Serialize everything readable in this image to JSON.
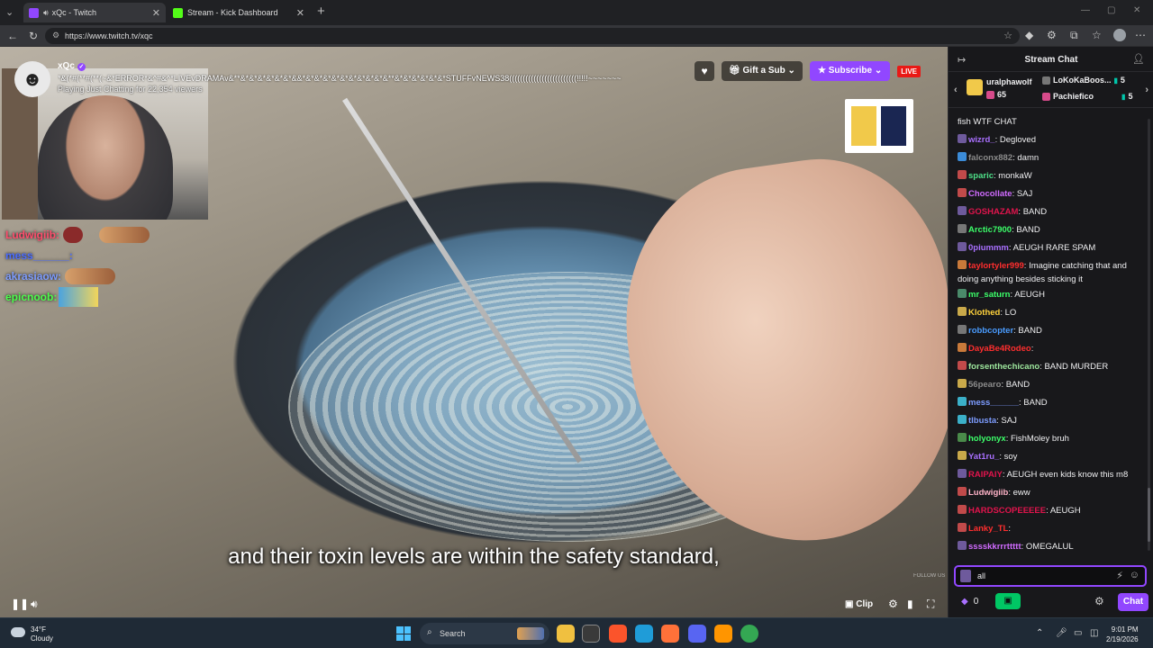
{
  "browser": {
    "tabs": [
      {
        "title": "xQc - Twitch",
        "active": true,
        "audio": true,
        "favicon_color": "#9147ff"
      },
      {
        "title": "Stream - Kick Dashboard",
        "active": false,
        "audio": false,
        "favicon_color": "#53fc18"
      }
    ],
    "url": "https://www.twitch.tv/xqc"
  },
  "stream": {
    "channel": "xQc",
    "title": "*&(*#(**#(**(~&*ERROR*&^#&^*LIVEvDRAMAv&**&*&*&*&*&*&*&&*&*&*&*&*&*&*&*&*&*&**&*&*&*&*&*&*STUFFvNEWS38(((((((((((((((((((((((((!!!!!~~~~~~~",
    "meta": "Playing Just Chatting for 22,354 viewers",
    "gift_label": "Gift a Sub",
    "subscribe_label": "Subscribe",
    "live_label": "LIVE",
    "caption": "and their toxin levels are within the safety standard,",
    "watermark": "FOLLOW US",
    "clip_label": "Clip",
    "overlay_chat": [
      {
        "user": "Ludwigiib:",
        "color": "#ff4d6d"
      },
      {
        "user": "mess______:",
        "color": "#4a6cff"
      },
      {
        "user": "akrasiaow:",
        "color": "#7d9cff"
      },
      {
        "user": "epicnoob:",
        "color": "#4cff4c"
      }
    ]
  },
  "chat": {
    "header": "Stream Chat",
    "gifters": [
      {
        "name": "uralphawolf",
        "count": "65"
      },
      {
        "name": "LoKoKaBoos...",
        "count": "5"
      },
      {
        "name": "Pachiefico",
        "count": "5"
      }
    ],
    "messages": [
      {
        "user": "",
        "text": "fish WTF CHAT",
        "color": "#efeff1",
        "badge": ""
      },
      {
        "user": "wizrd_",
        "text": ": Degloved",
        "color": "#a970ff",
        "badge": "#6e5a9c"
      },
      {
        "user": "falconx882",
        "text": ": damn",
        "color": "#8b8b8b",
        "badge": "#3b8bd8"
      },
      {
        "user": "sparic",
        "text": ": monkaW",
        "color": "#4ee089",
        "badge": "#c14a4a"
      },
      {
        "user": "Chocollate",
        "text": ": SAJ",
        "color": "#d06bff",
        "badge": "#c14a4a"
      },
      {
        "user": "GOSHAZAM",
        "text": ": BAND",
        "color": "#e0144c",
        "badge": "#6e5a9c"
      },
      {
        "user": "Arctic7900",
        "text": ": BAND",
        "color": "#3cff6a",
        "badge": "#777"
      },
      {
        "user": "0piummm",
        "text": ": AEUGH RARE SPAM",
        "color": "#a970ff",
        "badge": "#6e5a9c"
      },
      {
        "user": "taylortyler999",
        "text": ": Imagine catching that and doing anything besides sticking it",
        "color": "#ff2e2e",
        "badge": "#c97a3a"
      },
      {
        "user": "mr_saturn",
        "text": ": AEUGH",
        "color": "#3cff6a",
        "badge": "#4a8a6a"
      },
      {
        "user": "Klothed",
        "text": ": LO",
        "color": "#ffd23c",
        "badge": "#c9a94a"
      },
      {
        "user": "robbcopter",
        "text": ": BAND",
        "color": "#4a9cff",
        "badge": "#777"
      },
      {
        "user": "DayaBe4Rodeo",
        "text": ":",
        "color": "#ff2e2e",
        "badge": "#c97a3a"
      },
      {
        "user": "forsenthechicano",
        "text": ": BAND MURDER",
        "color": "#9ee89e",
        "badge": "#c14a4a"
      },
      {
        "user": "56pearo",
        "text": ": BAND",
        "color": "#8b8b8b",
        "badge": "#c9a94a"
      },
      {
        "user": "mess______",
        "text": ": BAND",
        "color": "#7d9cff",
        "badge": "#3bb0c9"
      },
      {
        "user": "tlbusta",
        "text": ": SAJ",
        "color": "#7d9cff",
        "badge": "#3bb0c9"
      },
      {
        "user": "holyonyx",
        "text": ": FishMoley bruh",
        "color": "#3cff6a",
        "badge": "#4a8a4a"
      },
      {
        "user": "Yat1ru_",
        "text": ": soy",
        "color": "#a970ff",
        "badge": "#c9a94a"
      },
      {
        "user": "RAIPAIY",
        "text": ": AEUGH even kids know this m8",
        "color": "#e0144c",
        "badge": "#6e5a9c"
      },
      {
        "user": "Ludwigiib",
        "text": ": eww",
        "color": "#ffb3c8",
        "badge": "#c14a4a"
      },
      {
        "user": "HARDSCOPEEEEE",
        "text": ": AEUGH",
        "color": "#e0144c",
        "badge": "#c14a4a"
      },
      {
        "user": "Lanky_TL",
        "text": ":",
        "color": "#ff2e2e",
        "badge": "#c14a4a"
      },
      {
        "user": "sssskkrrrttttt",
        "text": ": OMEGALUL",
        "color": "#d06bff",
        "badge": "#6e5a9c"
      }
    ],
    "input_value": "all",
    "points": "0",
    "send_label": "Chat"
  },
  "taskbar": {
    "temp": "34°F",
    "condition": "Cloudy",
    "search_label": "Search",
    "time": "9:01 PM",
    "date": "2/19/2026"
  }
}
